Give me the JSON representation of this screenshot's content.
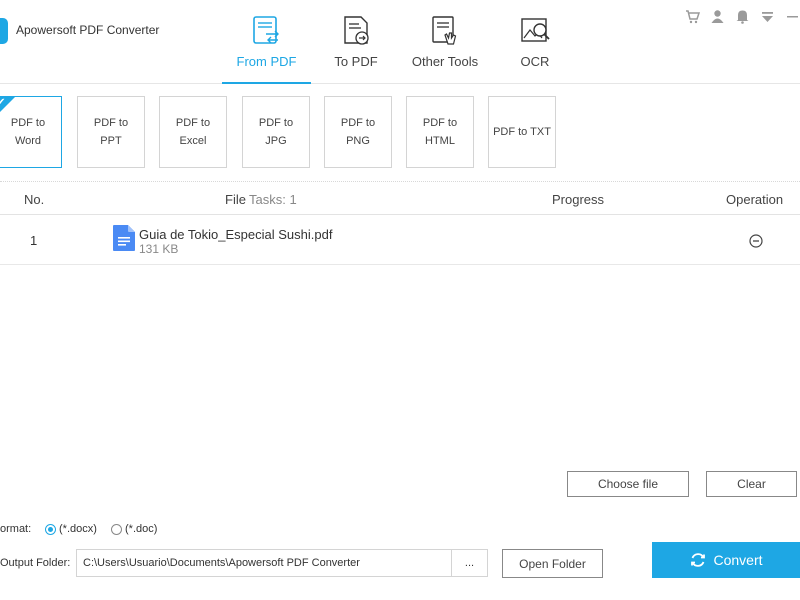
{
  "app": {
    "title": "Apowersoft PDF Converter"
  },
  "nav": {
    "tabs": [
      {
        "label": "From PDF",
        "icon": "from-pdf-icon",
        "active": true
      },
      {
        "label": "To PDF",
        "icon": "to-pdf-icon"
      },
      {
        "label": "Other Tools",
        "icon": "other-tools-icon"
      },
      {
        "label": "OCR",
        "icon": "ocr-icon"
      }
    ]
  },
  "top_icons": [
    "cart-icon",
    "user-icon",
    "bell-icon",
    "menu-down-icon",
    "minimize-icon"
  ],
  "options": [
    {
      "label": "PDF to Word",
      "selected": true
    },
    {
      "label": "PDF to PPT"
    },
    {
      "label": "PDF to Excel"
    },
    {
      "label": "PDF to JPG"
    },
    {
      "label": "PDF to PNG"
    },
    {
      "label": "PDF to HTML"
    },
    {
      "label": "PDF to TXT"
    }
  ],
  "table": {
    "headers": {
      "no": "No.",
      "file": "File",
      "tasks": "Tasks: 1",
      "progress": "Progress",
      "operation": "Operation"
    },
    "rows": [
      {
        "no": "1",
        "name": "Guia de Tokio_Especial Sushi.pdf",
        "size": "131 KB"
      }
    ]
  },
  "actions": {
    "choose_file": "Choose file",
    "clear": "Clear"
  },
  "format": {
    "label": "ormat:",
    "options": [
      {
        "label": "(*.docx)",
        "checked": true
      },
      {
        "label": "(*.doc)",
        "checked": false
      }
    ]
  },
  "output": {
    "label": "Output Folder:",
    "path": "C:\\Users\\Usuario\\Documents\\Apowersoft PDF Converter",
    "browse": "...",
    "open_folder": "Open Folder"
  },
  "convert": {
    "label": "Convert"
  },
  "colors": {
    "accent": "#1ea7e4"
  }
}
